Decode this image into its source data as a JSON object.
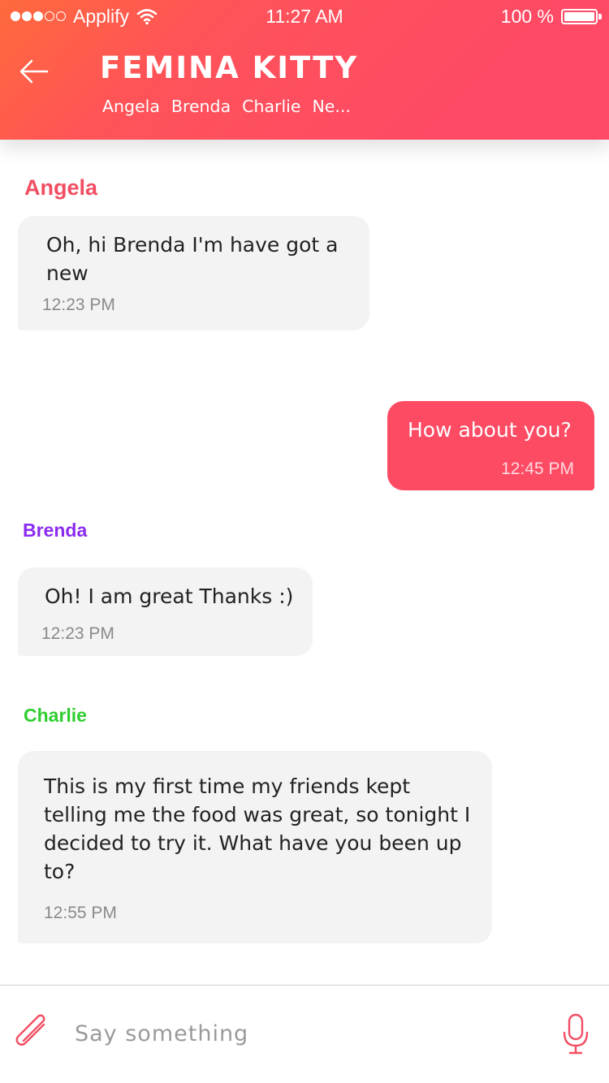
{
  "status_bar": {
    "carrier": "Applify",
    "time": "11:27 AM",
    "battery": "100 %"
  },
  "header": {
    "title": "FEMINA KITTY",
    "members": [
      "Angela",
      "Brenda",
      "Charlie",
      "Ne..."
    ]
  },
  "messages": [
    {
      "sender": "Angela",
      "sender_color": "#f24e63",
      "text": "Oh, hi Brenda I'm have got a new",
      "time": "12:23 PM",
      "outgoing": false
    },
    {
      "sender": "",
      "text": "How about you?",
      "time": "12:45 PM",
      "outgoing": true
    },
    {
      "sender": "Brenda",
      "sender_color": "#8b2cf0",
      "text": "Oh! I am great Thanks :)",
      "time": "12:23 PM",
      "outgoing": false
    },
    {
      "sender": "Charlie",
      "sender_color": "#2fce2f",
      "text": "This is my first time my friends kept telling me the food was great, so tonight I decided to try it. What have you been up to?",
      "time": "12:55 PM",
      "outgoing": false
    }
  ],
  "composer": {
    "placeholder": "Say something"
  },
  "icons": {
    "back": "arrow-left-icon",
    "attach": "paperclip-icon",
    "mic": "microphone-icon",
    "wifi": "wifi-icon",
    "battery": "battery-icon"
  },
  "colors": {
    "accent": "#fd4b64",
    "incoming_bubble": "#f3f3f3"
  }
}
